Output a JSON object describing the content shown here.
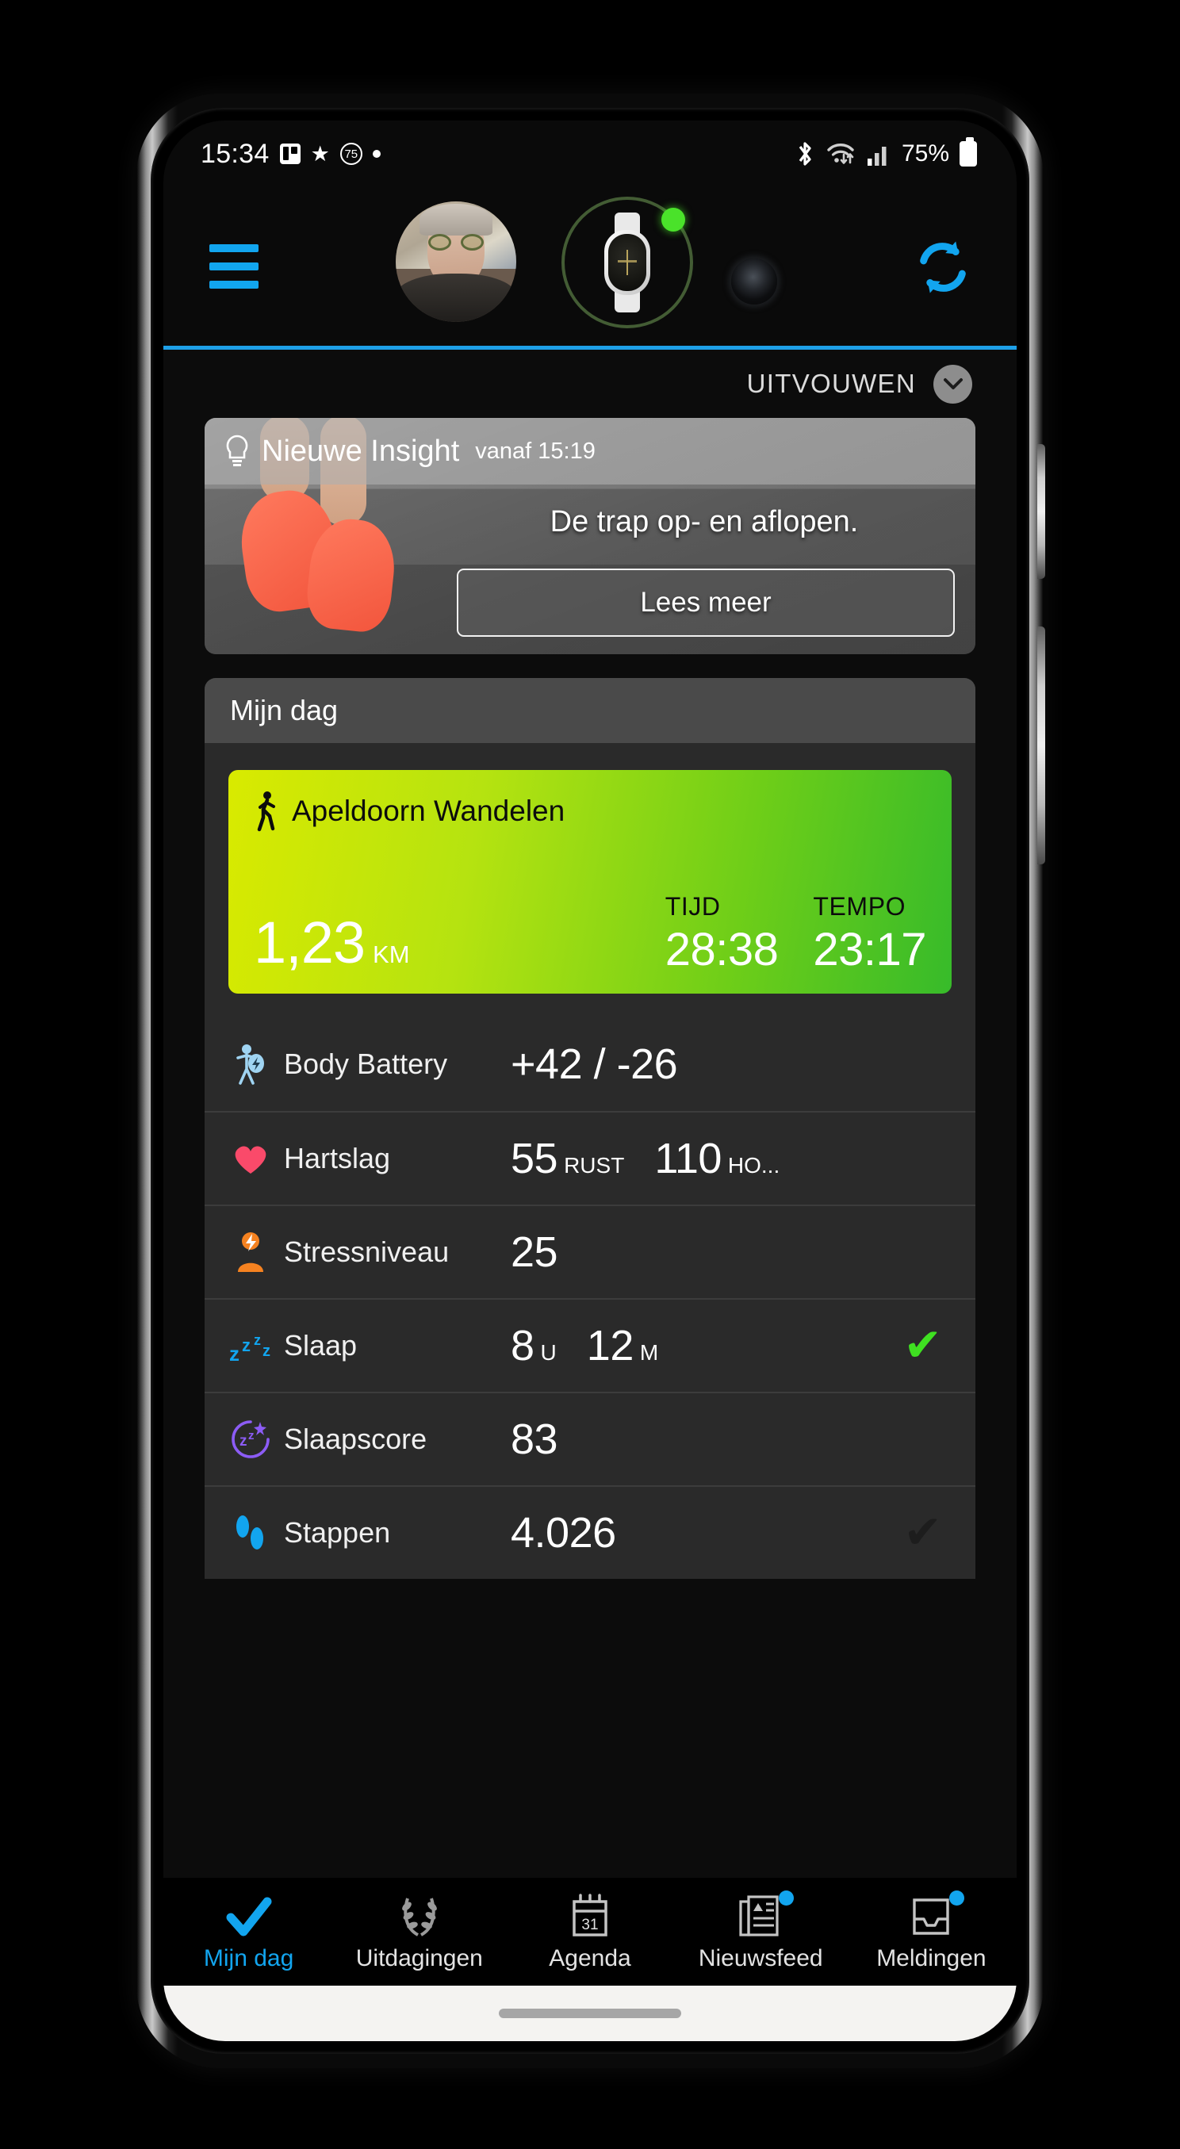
{
  "statusbar": {
    "time": "15:34",
    "icons": [
      "trello-icon",
      "star-icon",
      "circle-75-icon",
      "dot-icon"
    ],
    "badge_count": "75",
    "battery_text": "75%",
    "right_icons": [
      "bluetooth-icon",
      "wifi-icon",
      "signal-icon",
      "battery-icon"
    ]
  },
  "header": {
    "menu_icon": "hamburger-menu-icon",
    "avatar_name": "user-avatar",
    "device_name": "smartwatch-device",
    "device_status": "connected",
    "sync_icon": "sync-refresh-icon",
    "accent_color": "#12a5ef",
    "device_ring_color": "#4d6b3c",
    "device_status_color": "#4ae22a"
  },
  "expand": {
    "label": "UITVOUWEN",
    "chevron": "chevron-down-icon"
  },
  "insight": {
    "icon": "lightbulb-icon",
    "title": "Nieuwe Insight",
    "time": "vanaf 15:19",
    "body": "De trap op- en aflopen.",
    "button": "Lees meer"
  },
  "myday": {
    "header": "Mijn dag",
    "activity": {
      "icon": "walking-person-icon",
      "name": "Apeldoorn Wandelen",
      "distance_value": "1,23",
      "distance_unit": "KM",
      "stats": [
        {
          "label": "TIJD",
          "value": "28:38"
        },
        {
          "label": "TEMPO",
          "value": "23:17"
        }
      ],
      "gradient_from": "#d9ea00",
      "gradient_to": "#37bb2a"
    },
    "metrics": [
      {
        "icon": "body-battery-icon",
        "icon_color": "#9fd4f2",
        "label": "Body Battery",
        "values": [
          {
            "value": "+42 / -26",
            "unit": ""
          }
        ],
        "check": "none"
      },
      {
        "icon": "heart-icon",
        "icon_color": "#fa4a6a",
        "label": "Hartslag",
        "values": [
          {
            "value": "55",
            "unit": "RUST"
          },
          {
            "value": "110",
            "unit": "HO..."
          }
        ],
        "check": "none"
      },
      {
        "icon": "stress-person-icon",
        "icon_color": "#f58220",
        "label": "Stressniveau",
        "values": [
          {
            "value": "25",
            "unit": ""
          }
        ],
        "check": "none"
      },
      {
        "icon": "sleep-zzz-icon",
        "icon_color": "#12a5ef",
        "label": "Slaap",
        "values": [
          {
            "value": "8",
            "unit": "U"
          },
          {
            "value": "12",
            "unit": "M"
          }
        ],
        "check": "green"
      },
      {
        "icon": "sleep-score-icon",
        "icon_color": "#8c5cf5",
        "label": "Slaapscore",
        "values": [
          {
            "value": "83",
            "unit": ""
          }
        ],
        "check": "none"
      },
      {
        "icon": "footsteps-icon",
        "icon_color": "#12a5ef",
        "label": "Stappen",
        "values": [
          {
            "value": "4.026",
            "unit": ""
          }
        ],
        "check": "dark"
      }
    ]
  },
  "bottomnav": {
    "items": [
      {
        "label": "Mijn dag",
        "icon": "checkmark-icon",
        "active": true,
        "badge": false
      },
      {
        "label": "Uitdagingen",
        "icon": "laurel-wreath-icon",
        "active": false,
        "badge": false
      },
      {
        "label": "Agenda",
        "icon": "calendar-icon",
        "active": false,
        "badge": false,
        "calendar_day": "31"
      },
      {
        "label": "Nieuwsfeed",
        "icon": "newspaper-icon",
        "active": false,
        "badge": true
      },
      {
        "label": "Meldingen",
        "icon": "inbox-icon",
        "active": false,
        "badge": true
      }
    ]
  }
}
